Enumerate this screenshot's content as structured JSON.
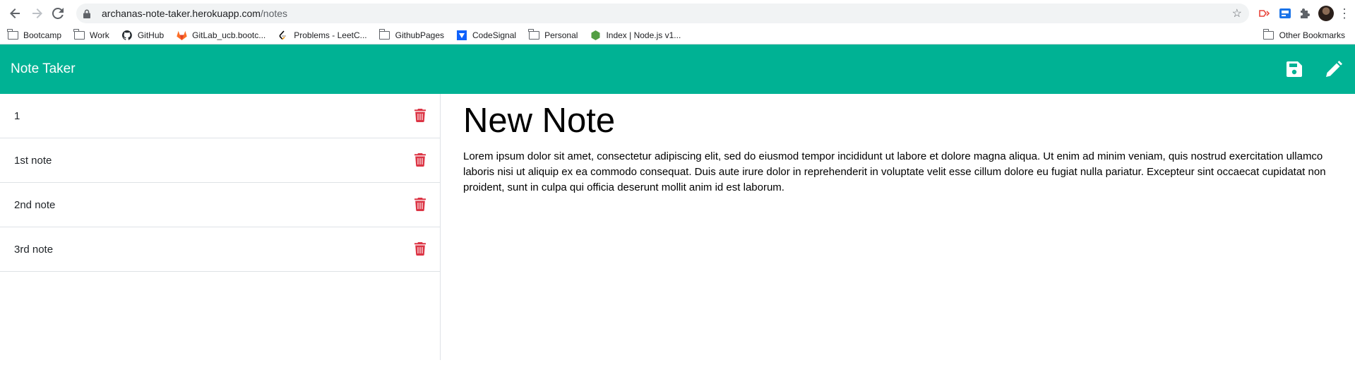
{
  "browser": {
    "url_host": "archanas-note-taker.herokuapp.com",
    "url_path": "/notes",
    "bookmarks": [
      {
        "label": "Bootcamp",
        "icon": "folder-icon"
      },
      {
        "label": "Work",
        "icon": "folder-icon"
      },
      {
        "label": "GitHub",
        "icon": "github-icon"
      },
      {
        "label": "GitLab_ucb.bootc...",
        "icon": "gitlab-icon"
      },
      {
        "label": "Problems - LeetC...",
        "icon": "leetcode-icon"
      },
      {
        "label": "GithubPages",
        "icon": "folder-icon"
      },
      {
        "label": "CodeSignal",
        "icon": "codesignal-icon"
      },
      {
        "label": "Personal",
        "icon": "folder-icon"
      },
      {
        "label": "Index | Node.js v1...",
        "icon": "nodejs-icon"
      }
    ],
    "other_bookmarks": "Other Bookmarks"
  },
  "app": {
    "title": "Note Taker",
    "accent_color": "#00b294",
    "delete_color": "#dc3545"
  },
  "notes": [
    {
      "title": "1"
    },
    {
      "title": "1st note"
    },
    {
      "title": "2nd note"
    },
    {
      "title": "3rd note"
    }
  ],
  "editor": {
    "title": "New Note",
    "body": "Lorem ipsum dolor sit amet, consectetur adipiscing elit, sed do eiusmod tempor incididunt ut labore et dolore magna aliqua. Ut enim ad minim veniam, quis nostrud exercitation ullamco laboris nisi ut aliquip ex ea commodo consequat. Duis aute irure dolor in reprehenderit in voluptate velit esse cillum dolore eu fugiat nulla pariatur. Excepteur sint occaecat cupidatat non proident, sunt in culpa qui officia deserunt mollit anim id est laborum."
  }
}
